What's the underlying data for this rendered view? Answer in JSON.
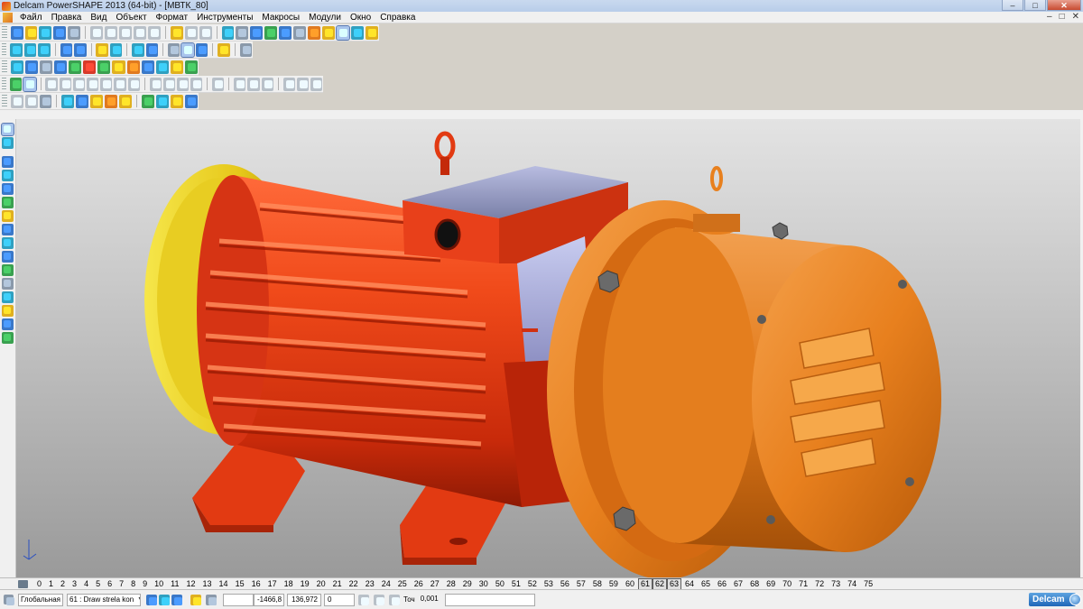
{
  "window": {
    "title": "Delcam PowerSHAPE 2013 (64-bit) - [МВТК_80]",
    "minimize": "–",
    "maximize": "□",
    "close": "✕"
  },
  "menu": {
    "items": [
      "Файл",
      "Правка",
      "Вид",
      "Объект",
      "Формат",
      "Инструменты",
      "Макросы",
      "Модули",
      "Окно",
      "Справка"
    ],
    "mdi_minimize": "–",
    "mdi_restore": "□",
    "mdi_close": "✕"
  },
  "levels": {
    "values": [
      "0",
      "1",
      "2",
      "3",
      "4",
      "5",
      "6",
      "7",
      "8",
      "9",
      "10",
      "11",
      "12",
      "13",
      "14",
      "15",
      "16",
      "17",
      "18",
      "19",
      "20",
      "21",
      "22",
      "23",
      "24",
      "25",
      "26",
      "27",
      "28",
      "29",
      "30",
      "50",
      "51",
      "52",
      "53",
      "56",
      "57",
      "58",
      "59",
      "60",
      "61",
      "62",
      "63",
      "64",
      "65",
      "66",
      "67",
      "68",
      "69",
      "70",
      "71",
      "72",
      "73",
      "74",
      "75"
    ],
    "active": [
      "61",
      "62",
      "63"
    ]
  },
  "status": {
    "workplane": "Глобальная",
    "level_select": "61 : Draw strela kon",
    "coord_x": "-1466,8",
    "coord_y": "136,972",
    "coord_z": "0",
    "tolerance_label": "Точ",
    "tolerance_value": "0,001"
  },
  "brand": {
    "logo_text": "Delcam"
  },
  "icons": {
    "toolbar1": [
      "new-icon",
      "open-icon",
      "import-icon",
      "save-icon",
      "print-icon",
      "cut-icon",
      "copy-icon",
      "paste-icon",
      "undo-icon",
      "redo-icon",
      "zoom-icon",
      "view-iso-icon",
      "shade-icon",
      "wireframe-icon",
      "fit-icon",
      "rotate-icon",
      "home-icon",
      "ruler-icon"
    ],
    "toolbar2": [
      "select-icon",
      "sketch-icon",
      "line-icon",
      "arc-icon",
      "curve-icon",
      "surface-icon",
      "solid-icon",
      "mesh-icon",
      "color-icon",
      "assembly-icon",
      "feature-icon",
      "shade-icon"
    ],
    "toolbar3": [
      "box-icon",
      "cylinder-icon",
      "cone-icon",
      "sphere-icon",
      "torus-icon",
      "extrude-icon",
      "revolve-icon",
      "fillet-icon",
      "boolean-icon",
      "shell-icon",
      "split-icon",
      "blend-icon"
    ],
    "toolbar4": [
      "arrow-icon",
      "lines-icon",
      "plane-icon",
      "flip-icon",
      "tool-icon",
      "scale-icon",
      "mirror-icon",
      "offset-icon",
      "rotate-icon"
    ],
    "left": [
      "select-icon",
      "layers-icon",
      "copy-icon",
      "move-icon",
      "rotate-icon",
      "scale-icon",
      "mirror-icon",
      "surface-icon",
      "solid-icon",
      "assembly-icon",
      "analyze-icon",
      "measure-icon",
      "render-icon",
      "shade-icon",
      "check-icon",
      "view-icon"
    ]
  },
  "colors": {
    "motor_red": "#e83a18",
    "motor_yellow": "#f0d020",
    "brake_orange": "#e8801e",
    "terminal_box": "#9aa0c8",
    "bolt_gray": "#6a6a6a"
  }
}
